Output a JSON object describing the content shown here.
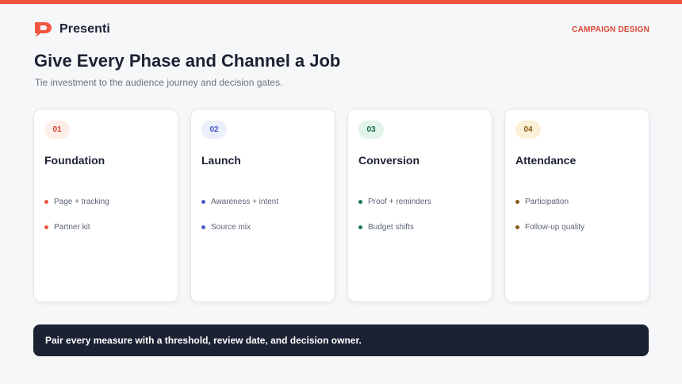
{
  "brand": {
    "name": "Presenti",
    "color": "#f2553f"
  },
  "tag": "CAMPAIGN DESIGN",
  "title": "Give Every Phase and Channel a Job",
  "subtitle": "Tie investment to the audience journey and decision gates.",
  "cards": [
    {
      "number": "01",
      "title": "Foundation",
      "badge_bg": "#fdeee9",
      "badge_fg": "#d94430",
      "dot_color": "#e8553f",
      "bullets": [
        "Page + tracking",
        "Partner kit"
      ]
    },
    {
      "number": "02",
      "title": "Launch",
      "badge_bg": "#ebeefb",
      "badge_fg": "#4858c4",
      "dot_color": "#4b5fc8",
      "bullets": [
        "Awareness + intent",
        "Source mix"
      ]
    },
    {
      "number": "03",
      "title": "Conversion",
      "badge_bg": "#e2f4ea",
      "badge_fg": "#1c6a47",
      "dot_color": "#1d7a52",
      "bullets": [
        "Proof + reminders",
        "Budget shifts"
      ]
    },
    {
      "number": "04",
      "title": "Attendance",
      "badge_bg": "#fcf1d8",
      "badge_fg": "#8a5a12",
      "dot_color": "#8a5a12",
      "bullets": [
        "Participation",
        "Follow-up quality"
      ]
    }
  ],
  "footer": "Pair every measure with a threshold, review date, and decision owner."
}
